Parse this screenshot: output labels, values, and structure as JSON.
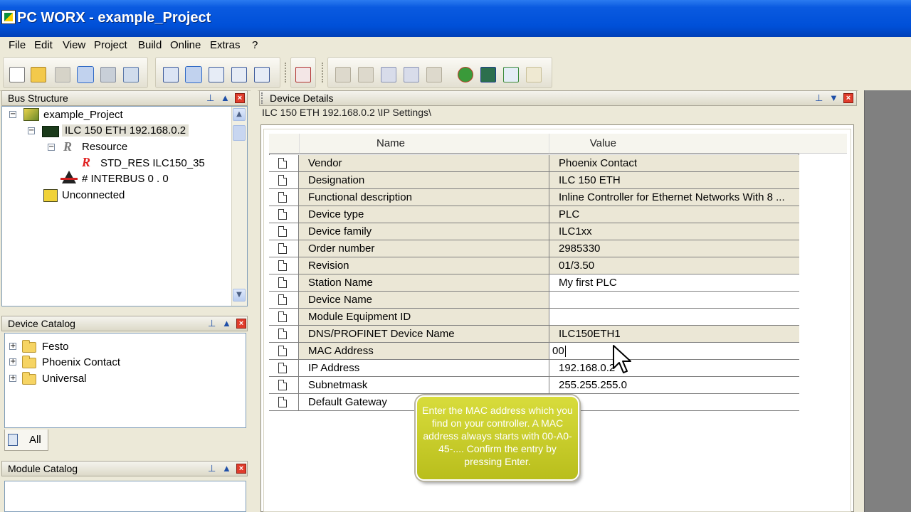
{
  "window": {
    "title": "PC WORX - example_Project"
  },
  "menu": [
    "File",
    "Edit",
    "View",
    "Project",
    "Build",
    "Online",
    "Extras",
    "?"
  ],
  "bus_structure": {
    "title": "Bus Structure",
    "tree": {
      "project": "example_Project",
      "controller": "ILC 150 ETH 192.168.0.2",
      "resource": "Resource",
      "std_res": "STD_RES ILC150_35",
      "interbus": "# INTERBUS 0 . 0",
      "unconnected": "Unconnected"
    }
  },
  "device_catalog": {
    "title": "Device Catalog",
    "items": [
      "Festo",
      "Phoenix Contact",
      "Universal"
    ],
    "tab": "All"
  },
  "module_catalog": {
    "title": "Module Catalog"
  },
  "device_details": {
    "title": "Device Details",
    "path": "ILC 150 ETH 192.168.0.2 \\IP Settings\\",
    "columns": {
      "name": "Name",
      "value": "Value"
    },
    "rows": [
      {
        "name": "Vendor",
        "value": "Phoenix Contact"
      },
      {
        "name": "Designation",
        "value": "ILC 150 ETH"
      },
      {
        "name": "Functional description",
        "value": "Inline Controller for Ethernet Networks With 8 ..."
      },
      {
        "name": "Device type",
        "value": "PLC"
      },
      {
        "name": "Device family",
        "value": "ILC1xx"
      },
      {
        "name": "Order number",
        "value": "2985330"
      },
      {
        "name": "Revision",
        "value": "01/3.50"
      },
      {
        "name": "Station Name",
        "value": "My first PLC"
      },
      {
        "name": "Device Name",
        "value": ""
      },
      {
        "name": "Module Equipment ID",
        "value": ""
      },
      {
        "name": "DNS/PROFINET Device Name",
        "value": "ILC150ETH1"
      },
      {
        "name": "MAC Address",
        "value": "00"
      },
      {
        "name": "IP Address",
        "value": "192.168.0.2"
      },
      {
        "name": "Subnetmask",
        "value": "255.255.255.0"
      },
      {
        "name": "Default Gateway",
        "value": ""
      }
    ]
  },
  "tooltip": {
    "text": "Enter the MAC address which you find on your controller. A MAC address always starts with 00-A0-45-.... Confirm the entry by pressing Enter."
  },
  "colors": {
    "title_bar": "#0050d8",
    "readonly_row": "#ebe7d6",
    "tooltip": "#c7cb2a"
  }
}
